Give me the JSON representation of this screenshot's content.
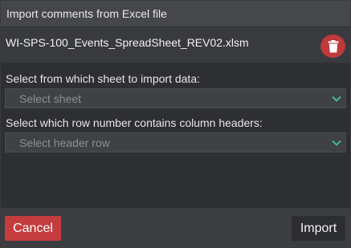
{
  "dialog": {
    "title": "Import comments from Excel file"
  },
  "file": {
    "name": "WI-SPS-100_Events_SpreadSheet_REV02.xlsm",
    "delete_icon": "trash-icon"
  },
  "sheet_select": {
    "label": "Select from which sheet to import data:",
    "placeholder": "Select sheet",
    "icon": "chevron-down-icon"
  },
  "header_row_select": {
    "label": "Select which row number contains column headers:",
    "placeholder": "Select header row",
    "icon": "chevron-down-icon"
  },
  "footer": {
    "cancel_label": "Cancel",
    "import_label": "Import"
  },
  "colors": {
    "danger": "#c43c3e",
    "chevron": "#3dbb8a",
    "background": "#2e2f33"
  }
}
